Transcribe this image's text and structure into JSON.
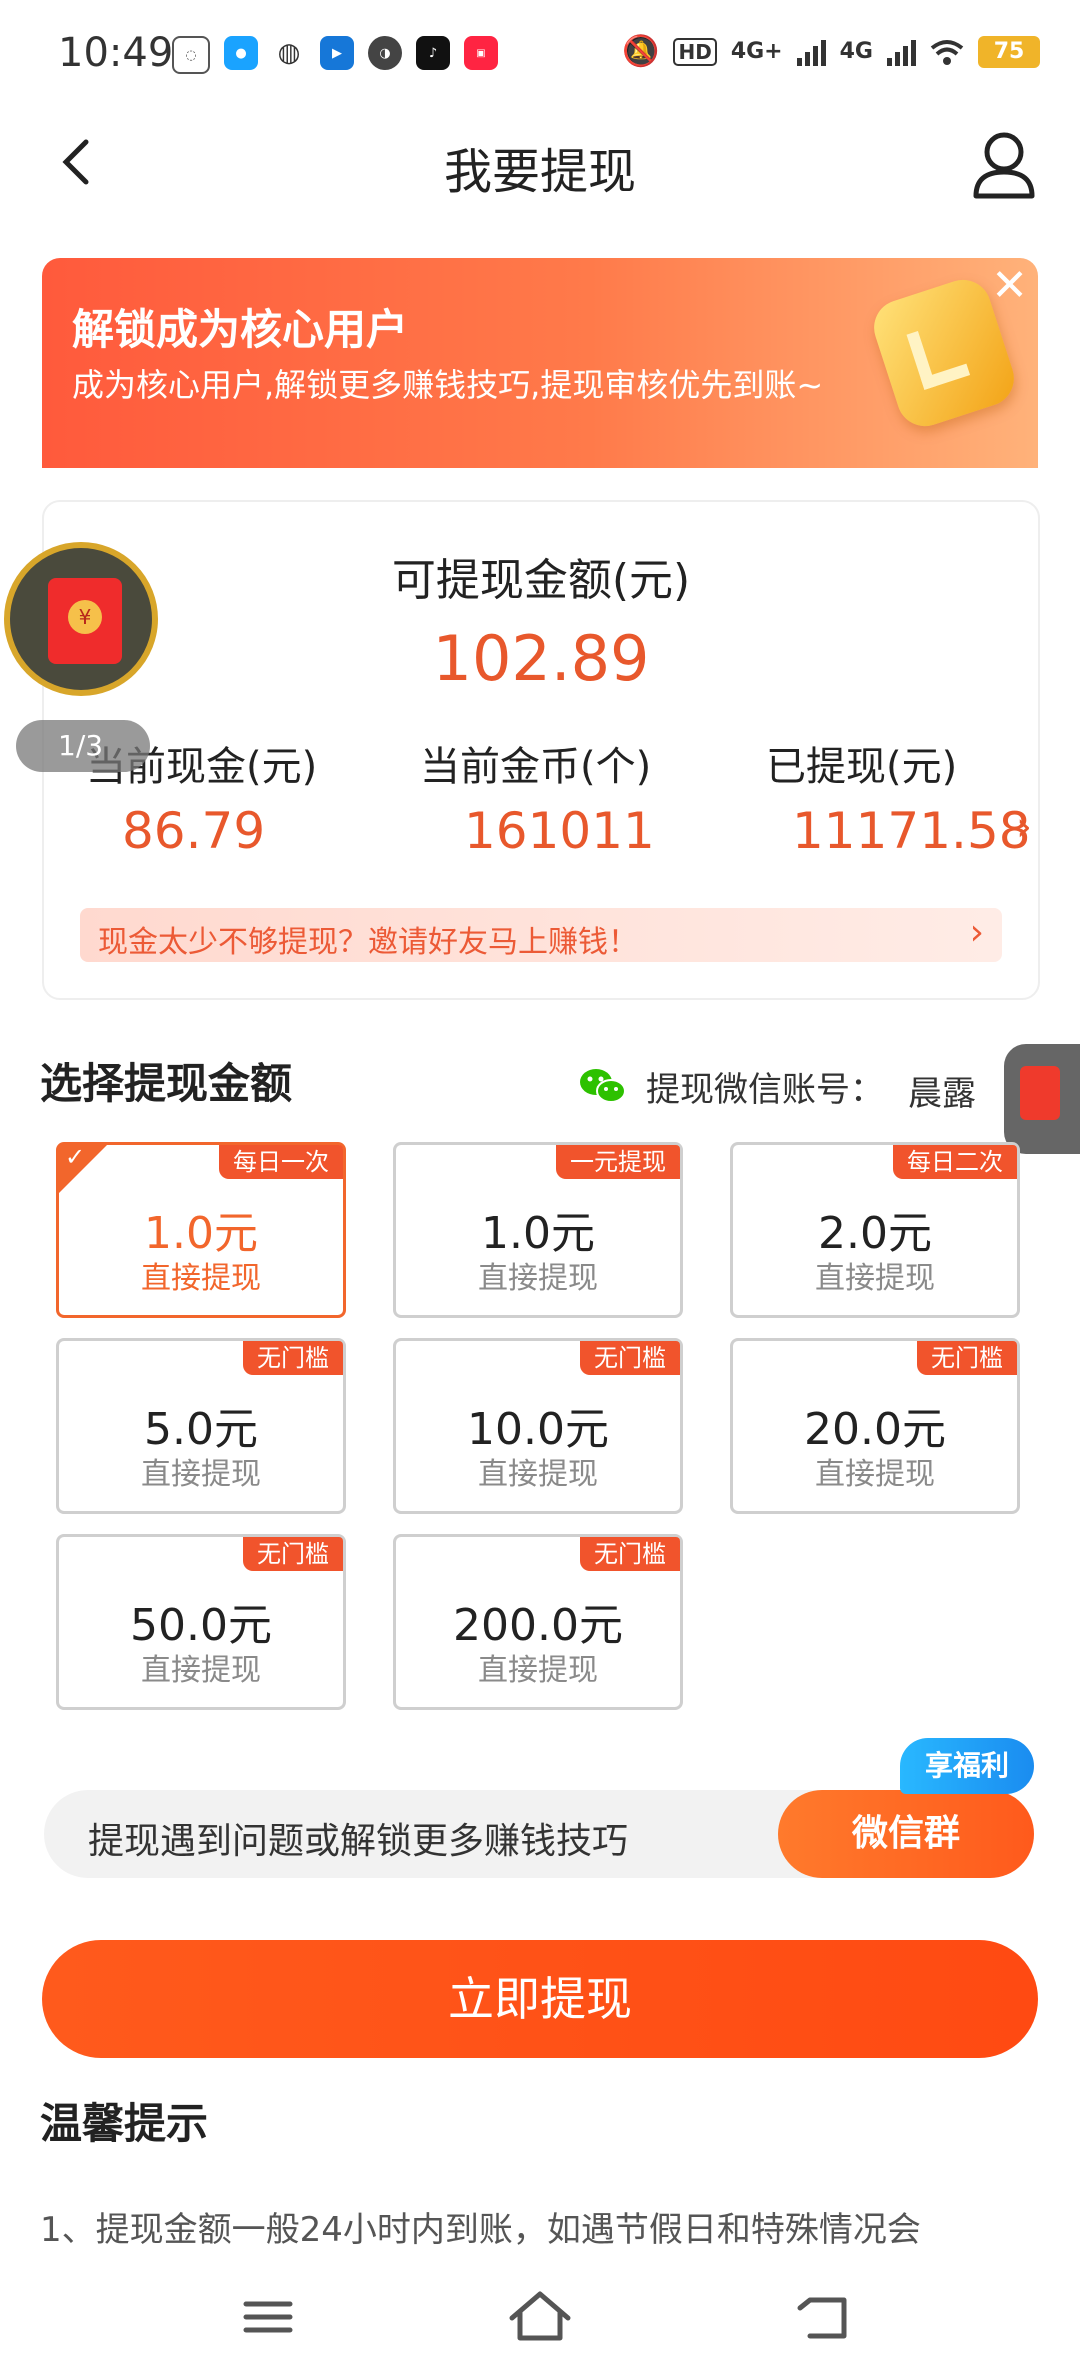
{
  "status_bar": {
    "time": "10:49",
    "network_1": "4G+",
    "network_2": "4G",
    "hd_label": "HD",
    "battery": "75"
  },
  "header": {
    "title": "我要提现"
  },
  "banner": {
    "title": "解锁成为核心用户",
    "subtitle": "成为核心用户,解锁更多赚钱技巧,提现审核优先到账~",
    "close": "✕"
  },
  "balance": {
    "title": "可提现金额(元)",
    "amount": "102.89",
    "stats": [
      {
        "label": "当前现金(元)",
        "value": "86.79"
      },
      {
        "label": "当前金币(个)",
        "value": "161011"
      },
      {
        "label": "已提现(元)",
        "value": "11171.58"
      }
    ],
    "arrow": "›",
    "invite_text": "现金太少不够提现？邀请好友马上赚钱！",
    "invite_arrow": "›"
  },
  "float": {
    "page_indicator": "1/3",
    "seal": "¥"
  },
  "withdraw": {
    "section_title": "选择提现金额",
    "wechat_label": "提现微信账号：",
    "wechat_name": "晨露",
    "options": [
      {
        "tag": "每日一次",
        "amount": "1.0元",
        "sub": "直接提现",
        "selected": true
      },
      {
        "tag": "一元提现",
        "amount": "1.0元",
        "sub": "直接提现",
        "selected": false
      },
      {
        "tag": "每日二次",
        "amount": "2.0元",
        "sub": "直接提现",
        "selected": false
      },
      {
        "tag": "无门槛",
        "amount": "5.0元",
        "sub": "直接提现",
        "selected": false
      },
      {
        "tag": "无门槛",
        "amount": "10.0元",
        "sub": "直接提现",
        "selected": false
      },
      {
        "tag": "无门槛",
        "amount": "20.0元",
        "sub": "直接提现",
        "selected": false
      },
      {
        "tag": "无门槛",
        "amount": "50.0元",
        "sub": "直接提现",
        "selected": false
      },
      {
        "tag": "无门槛",
        "amount": "200.0元",
        "sub": "直接提现",
        "selected": false
      }
    ],
    "check": "✓"
  },
  "help": {
    "text": "提现遇到问题或解锁更多赚钱技巧",
    "button": "微信群",
    "badge": "享福利"
  },
  "main_button": "立即提现",
  "tips": {
    "title": "温馨提示",
    "line1": "1、提现金额一般24小时内到账，如遇节假日和特殊情况会"
  },
  "colors": {
    "accent": "#ff5a1c",
    "amount": "#e8582c",
    "tag": "#f1542c"
  }
}
